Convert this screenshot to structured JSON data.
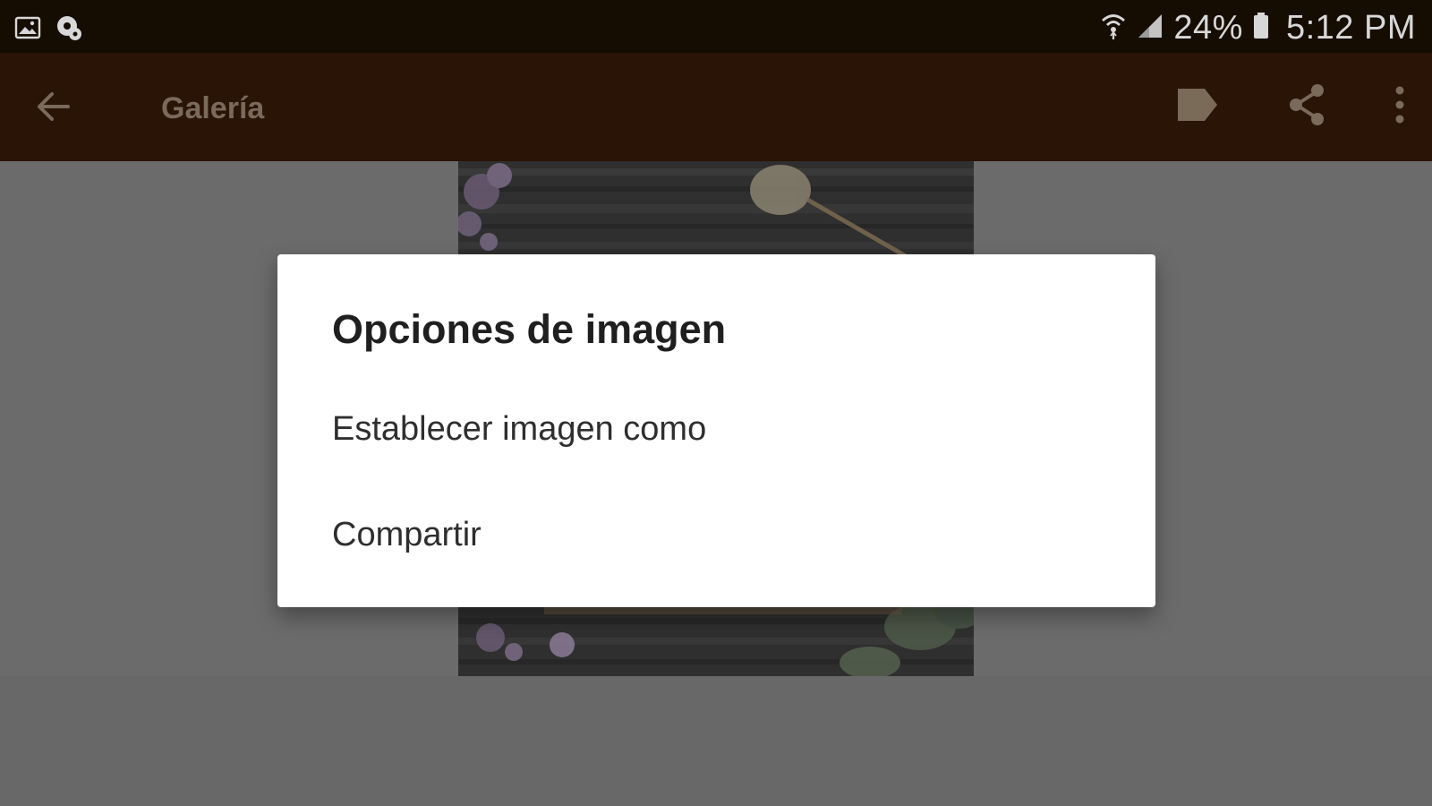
{
  "status_bar": {
    "battery_percent": "24%",
    "time": "5:12 PM",
    "left_icons": [
      "image-notification-icon",
      "settings-notification-icon"
    ],
    "right_icons": [
      "wifi-icon",
      "cellular-signal-icon",
      "battery-icon"
    ]
  },
  "app_bar": {
    "title": "Galería",
    "icons": [
      "back-arrow-icon",
      "label-icon",
      "share-icon",
      "more-vert-icon"
    ]
  },
  "dialog": {
    "title": "Opciones de imagen",
    "items": [
      {
        "label": "Establecer imagen como"
      },
      {
        "label": "Compartir"
      }
    ]
  },
  "colors": {
    "status_bar_bg": "#150c02",
    "app_bar_bg": "#2a1405",
    "scrim_bg": "#666666",
    "dialog_bg": "#ffffff",
    "title_text": "#1f1f1f",
    "item_text": "#2e2e2e"
  }
}
